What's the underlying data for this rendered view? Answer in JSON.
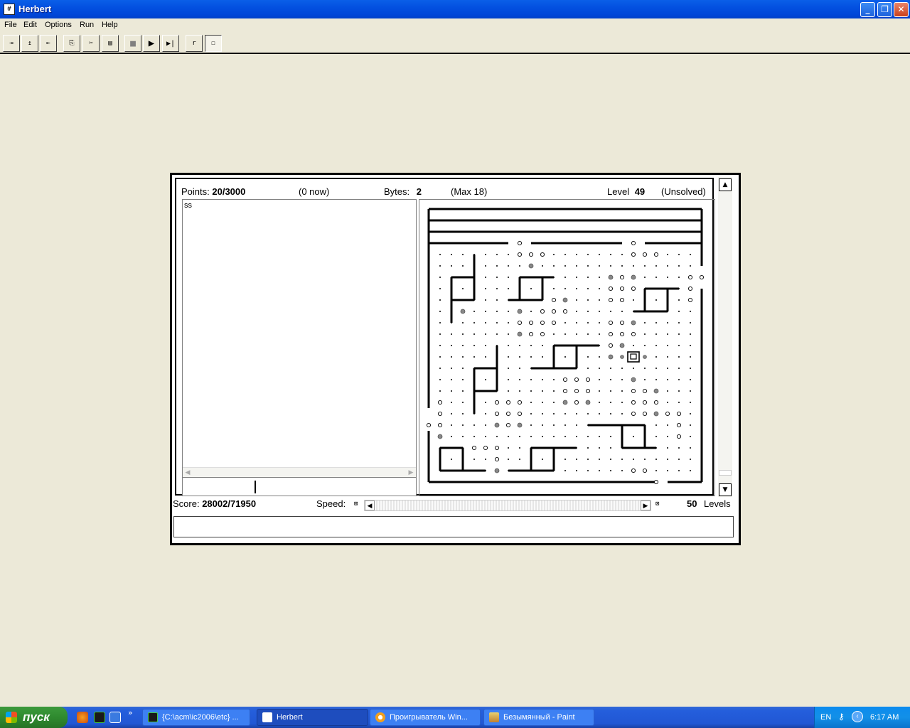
{
  "window": {
    "title": "Herbert"
  },
  "menu": [
    "File",
    "Edit",
    "Options",
    "Run",
    "Help"
  ],
  "toolbar": {
    "buttons": [
      {
        "name": "open-button",
        "glyph": "⇥"
      },
      {
        "name": "save-button",
        "glyph": "↥"
      },
      {
        "name": "export-button",
        "glyph": "⇤"
      },
      {
        "name": "copy-button",
        "glyph": "⎘"
      },
      {
        "name": "cut-button",
        "glyph": "✂"
      },
      {
        "name": "paste-button",
        "glyph": "▤"
      },
      {
        "name": "stop-button",
        "glyph": "■"
      },
      {
        "name": "run-button",
        "glyph": "▶"
      },
      {
        "name": "step-button",
        "glyph": "▶|"
      },
      {
        "name": "reset-button",
        "glyph": "r"
      },
      {
        "name": "robot-button",
        "glyph": "☐"
      }
    ]
  },
  "stats": {
    "points_label": "Points:",
    "points_value": "20/3000",
    "points_now": "(0 now)",
    "bytes_label": "Bytes:",
    "bytes_value": "2",
    "bytes_max": "(Max 18)",
    "level_label": "Level",
    "level_value": "49",
    "level_status": "(Unsolved)"
  },
  "code": {
    "text": "ss"
  },
  "footer": {
    "score_label": "Score:",
    "score_value": "28002/71950",
    "speed_label": "Speed:",
    "levels_count": "50",
    "levels_label": "Levels"
  },
  "taskbar": {
    "start_label": "пуск",
    "tasks": [
      {
        "label": "{C:\\acm\\ic2006\\etc} ...",
        "active": false
      },
      {
        "label": "Herbert",
        "active": true
      },
      {
        "label": "Проигрыватель Win...",
        "active": false
      },
      {
        "label": "Безымянный - Paint",
        "active": false
      }
    ],
    "language": "EN",
    "clock": "6:17 AM"
  },
  "colors": {
    "titlebar": "#0054E3",
    "desktop": "#ECE9D8",
    "taskbar": "#245EDC",
    "start": "#2F8A2F",
    "grey_dot": "#888888"
  }
}
